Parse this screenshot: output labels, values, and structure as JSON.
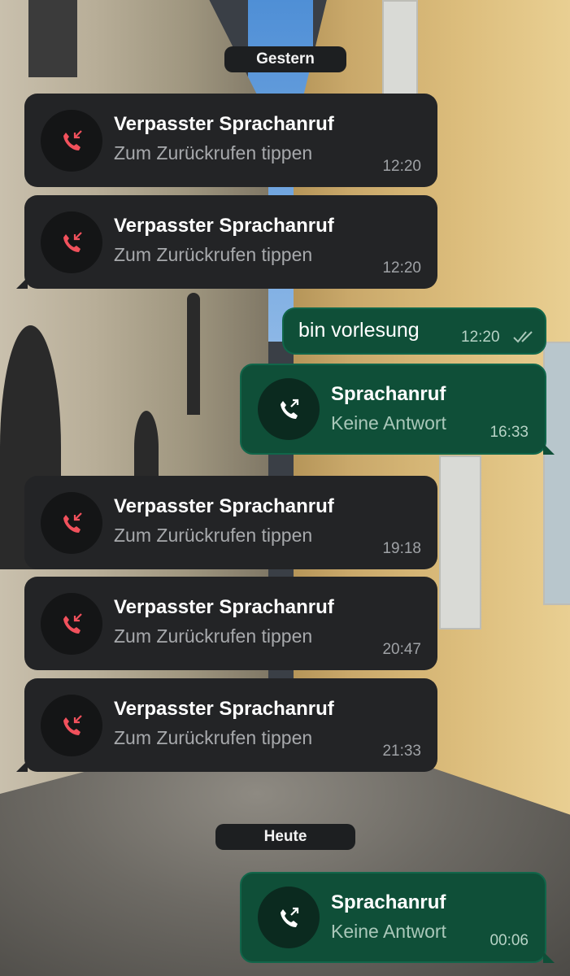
{
  "date_separators": {
    "yesterday": "Gestern",
    "today": "Heute"
  },
  "messages": [
    {
      "type": "missed_call",
      "title": "Verpasster Sprachanruf",
      "subtitle": "Zum Zurückrufen tippen",
      "time": "12:20",
      "icon": "missed-call-icon"
    },
    {
      "type": "missed_call",
      "title": "Verpasster Sprachanruf",
      "subtitle": "Zum Zurückrufen tippen",
      "time": "12:20",
      "icon": "missed-call-icon"
    },
    {
      "type": "text_out",
      "text": "bin vorlesung",
      "time": "12:20",
      "status": "read"
    },
    {
      "type": "outgoing_call",
      "title": "Sprachanruf",
      "subtitle": "Keine Antwort",
      "time": "16:33",
      "icon": "outgoing-call-icon"
    },
    {
      "type": "missed_call",
      "title": "Verpasster Sprachanruf",
      "subtitle": "Zum Zurückrufen tippen",
      "time": "19:18",
      "icon": "missed-call-icon"
    },
    {
      "type": "missed_call",
      "title": "Verpasster Sprachanruf",
      "subtitle": "Zum Zurückrufen tippen",
      "time": "20:47",
      "icon": "missed-call-icon"
    },
    {
      "type": "missed_call",
      "title": "Verpasster Sprachanruf",
      "subtitle": "Zum Zurückrufen tippen",
      "time": "21:33",
      "icon": "missed-call-icon"
    },
    {
      "type": "outgoing_call",
      "title": "Sprachanruf",
      "subtitle": "Keine Antwort",
      "time": "00:06",
      "icon": "outgoing-call-icon"
    }
  ],
  "colors": {
    "missed_call_red": "#f1515c",
    "incoming_bubble": "#232426",
    "outgoing_bubble": "#0f4f38",
    "read_ticks": "#a9c7b9"
  }
}
